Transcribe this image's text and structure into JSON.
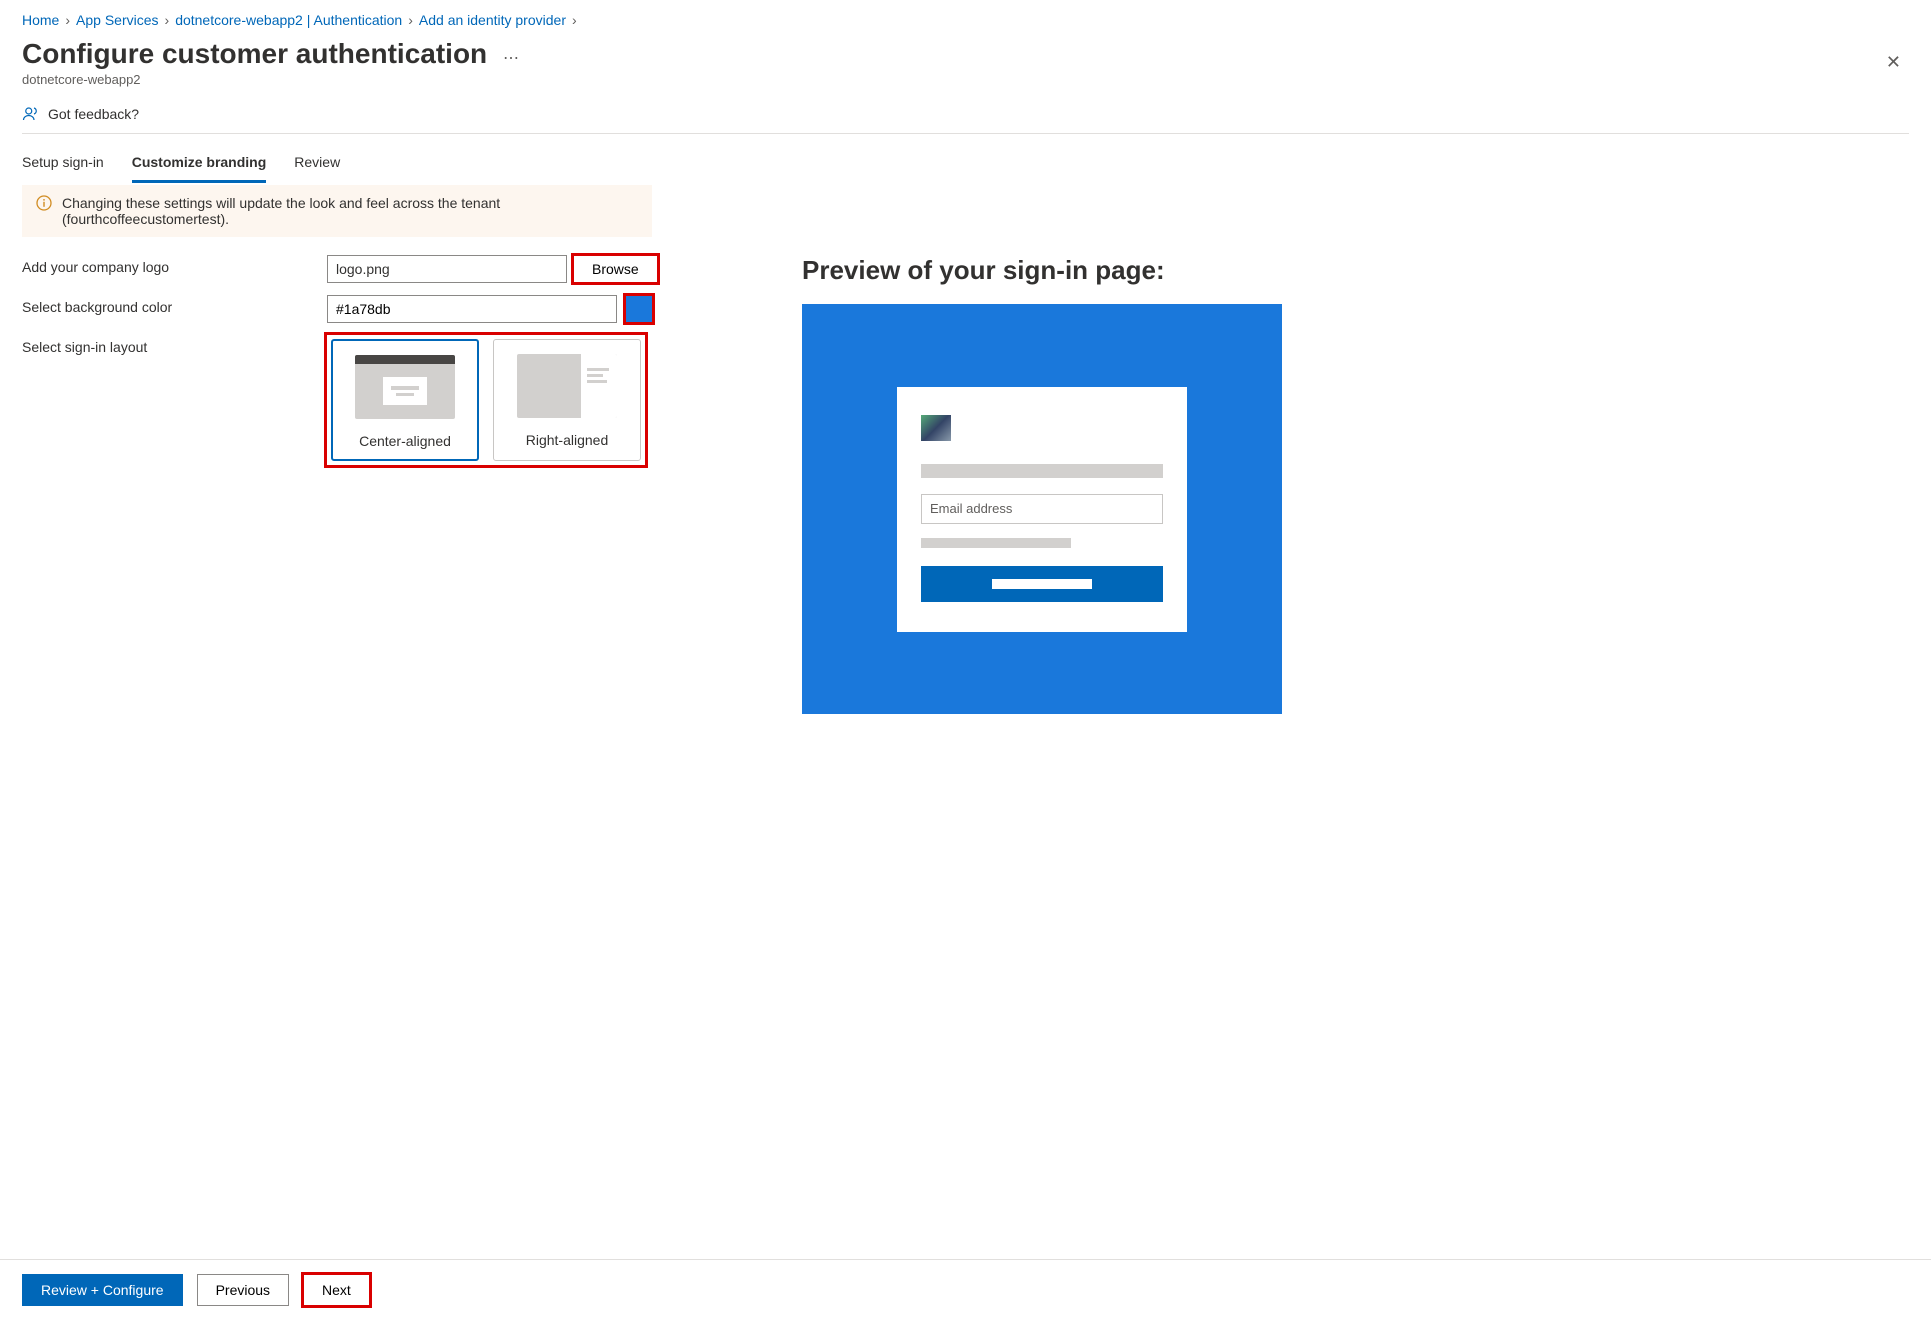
{
  "breadcrumb": {
    "items": [
      "Home",
      "App Services",
      "dotnetcore-webapp2 | Authentication",
      "Add an identity provider"
    ]
  },
  "header": {
    "title": "Configure customer authentication",
    "subtitle": "dotnetcore-webapp2"
  },
  "feedback": {
    "label": "Got feedback?"
  },
  "tabs": {
    "setup": "Setup sign-in",
    "branding": "Customize branding",
    "review": "Review"
  },
  "infobar": {
    "text": "Changing these settings will update the look and feel across the tenant (fourthcoffeecustomertest)."
  },
  "form": {
    "logo_label": "Add your company logo",
    "logo_value": "logo.png",
    "browse_label": "Browse",
    "bg_label": "Select background color",
    "bg_value": "#1a78db",
    "layout_label": "Select sign-in layout",
    "layout_center": "Center-aligned",
    "layout_right": "Right-aligned"
  },
  "preview": {
    "title": "Preview of your sign-in page:",
    "email_placeholder": "Email address",
    "bg_color": "#1a78db"
  },
  "footer": {
    "review": "Review + Configure",
    "previous": "Previous",
    "next": "Next"
  }
}
